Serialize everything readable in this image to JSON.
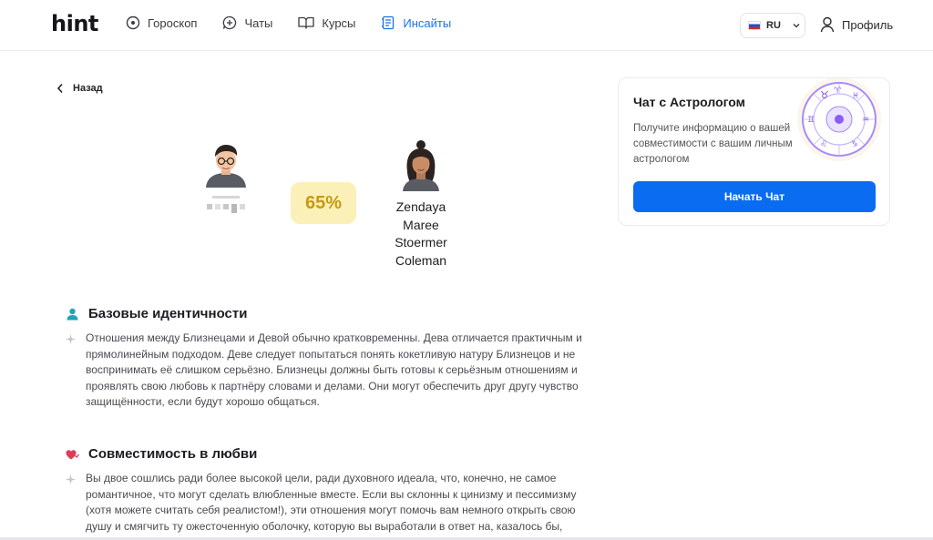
{
  "header": {
    "logo": "hint",
    "nav": [
      {
        "label": "Гороскоп",
        "icon": "target-icon",
        "active": false
      },
      {
        "label": "Чаты",
        "icon": "chat-plus-icon",
        "active": false
      },
      {
        "label": "Курсы",
        "icon": "book-icon",
        "active": false
      },
      {
        "label": "Инсайты",
        "icon": "insights-icon",
        "active": true
      }
    ],
    "language": "RU",
    "profile_label": "Профиль"
  },
  "back_label": "Назад",
  "compatibility": {
    "percent": "65%",
    "person2_name_lines": [
      "Zendaya",
      "Maree",
      "Stoermer",
      "Coleman"
    ]
  },
  "sections": [
    {
      "title": "Базовые идентичности",
      "icon": "person-icon",
      "text": "Отношения между Близнецами и Девой обычно кратковременны. Дева отличается практичным и прямолинейным подходом. Деве следует попытаться понять кокетливую натуру Близнецов и не воспринимать её слишком серьёзно. Близнецы должны быть готовы к серьёзным отношениям и проявлять свою любовь к партнёру словами и делами. Они могут обеспечить друг другу чувство защищённости, если будут хорошо общаться."
    },
    {
      "title": "Совместимость в любви",
      "icon": "hearts-icon",
      "text": "Вы двое сошлись ради более высокой цели, ради духовного идеала, что, конечно, не самое романтичное, что могут сделать влюбленные вместе. Если вы склонны к цинизму и пессимизму (хотя можете считать себя реалистом!), эти отношения могут помочь вам немного открыть свою душу и смягчить ту ожесточенную оболочку, которую вы выработали в ответ на, казалось бы,"
    }
  ],
  "card": {
    "title": "Чат с Астрологом",
    "text": "Получите информацию о вашей совместимости с вашим личным астрологом",
    "button": "Начать Чат"
  },
  "colors": {
    "accent": "#0a6cf0",
    "nav_active": "#1a73e8",
    "percent_bg": "#fbf1b8",
    "percent_text": "#c59a10",
    "zodiac": "#8b5cf6"
  }
}
